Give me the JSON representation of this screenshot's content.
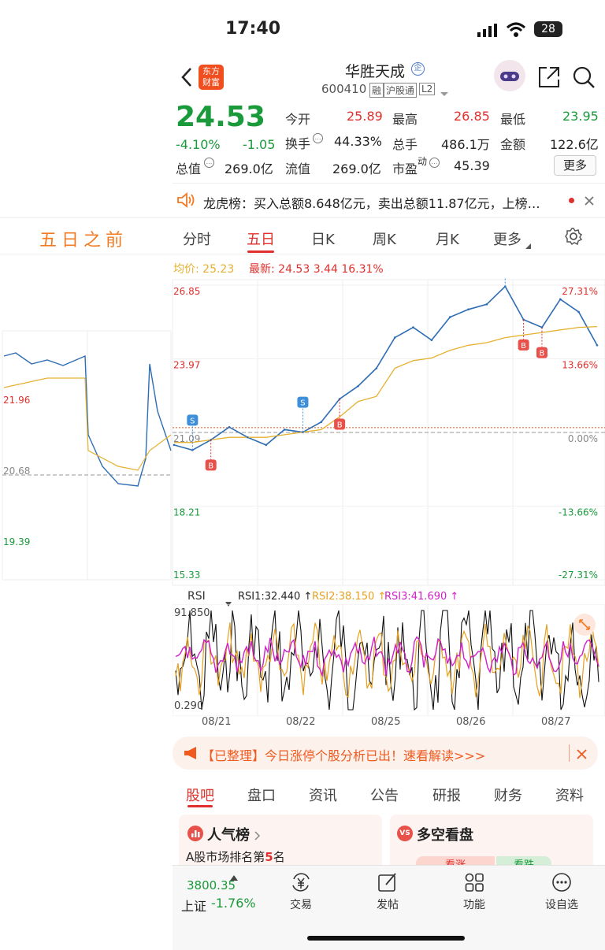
{
  "status_bar": {
    "time": "17:40",
    "battery": "28"
  },
  "header": {
    "logo_text": "东方财富",
    "stock_name": "华胜天成",
    "stock_code": "600410",
    "tags": [
      "融",
      "沪股通",
      "L2"
    ]
  },
  "quote": {
    "price": "24.53",
    "change_pct": "-4.10%",
    "change": "-1.05",
    "fields": [
      {
        "label": "今开",
        "value": "25.89"
      },
      {
        "label": "最高",
        "value": "26.85"
      },
      {
        "label": "最低",
        "value": "23.95"
      },
      {
        "label": "换手",
        "value": "44.33%"
      },
      {
        "label": "总手",
        "value": "486.1万"
      },
      {
        "label": "金额",
        "value": "122.6亿"
      },
      {
        "label": "总值",
        "value": "269.0亿"
      },
      {
        "label": "流值",
        "value": "269.0亿"
      },
      {
        "label": "市盈",
        "sup": "动",
        "value": "45.39"
      }
    ],
    "more_label": "更多"
  },
  "notice": {
    "text": "龙虎榜：买入总额8.648亿元，卖出总额11.87亿元，上榜…"
  },
  "chart_tabs": {
    "left_title": "五日之前",
    "items": [
      "分时",
      "五日",
      "日K",
      "周K",
      "月K",
      "更多"
    ],
    "active": "五日"
  },
  "chart_header": {
    "avg_label": "均价:",
    "avg_value": "25.23",
    "latest_label": "最新:",
    "latest_value": "24.53",
    "latest_change": "3.44",
    "latest_pct": "16.31%"
  },
  "chart_data": {
    "type": "line",
    "y_ticks_left": [
      "26.85",
      "23.97",
      "21.09",
      "18.21",
      "15.33"
    ],
    "y_ticks_right": [
      "27.31%",
      "13.66%",
      "0.00%",
      "-13.66%",
      "-27.31%"
    ],
    "prev_chart_ticks": [
      "21.96",
      "20.68",
      "19.39"
    ],
    "x": [
      "08/21",
      "08/22",
      "08/25",
      "08/26",
      "08/27"
    ],
    "ylim": [
      15.33,
      26.85
    ],
    "series": [
      {
        "name": "价格",
        "values": [
          20.6,
          20.4,
          20.8,
          21.3,
          20.9,
          20.6,
          21.2,
          21.1,
          21.5,
          22.4,
          22.9,
          23.6,
          24.8,
          25.2,
          24.7,
          25.6,
          25.9,
          26.1,
          26.8,
          25.5,
          25.2,
          26.3,
          25.8,
          24.5
        ]
      },
      {
        "name": "均价",
        "values": [
          20.7,
          20.7,
          20.8,
          20.9,
          20.9,
          20.9,
          21.0,
          21.1,
          21.2,
          21.7,
          22.3,
          22.5,
          23.6,
          23.9,
          24.0,
          24.3,
          24.5,
          24.6,
          24.8,
          24.9,
          25.0,
          25.1,
          25.2,
          25.23
        ]
      }
    ],
    "markers": [
      "S",
      "B",
      "S",
      "B",
      "S",
      "B",
      "B"
    ]
  },
  "rsi": {
    "select_label": "RSI",
    "rsi1": "RSI1:32.440 ↑",
    "rsi2": "RSI2:38.150 ↑",
    "rsi3": "RSI3:41.690 ↑",
    "top": "91.850",
    "bottom": "0.290"
  },
  "banner": {
    "text": "【已整理】今日涨停个股分析已出！速看解读>>>"
  },
  "bottom_tabs": [
    "股吧",
    "盘口",
    "资讯",
    "公告",
    "研报",
    "财务",
    "资料"
  ],
  "cards": {
    "popularity_title": "人气榜",
    "popularity_sub_prefix": "A股市场排名第",
    "popularity_rank": "5",
    "popularity_sub_suffix": "名",
    "bullbear_title": "多空看盘",
    "bull": "看涨",
    "bear": "看跌"
  },
  "bottom_nav": {
    "index_value": "3800.35",
    "index_name": "上证",
    "index_change": "-1.76%",
    "items": [
      "交易",
      "发帖",
      "功能",
      "设自选"
    ]
  },
  "colors": {
    "up": "#e0302d",
    "down": "#1a9a3a",
    "price_line": "#2e6db4",
    "avg_line": "#e6b030",
    "accent": "#f27a21"
  }
}
